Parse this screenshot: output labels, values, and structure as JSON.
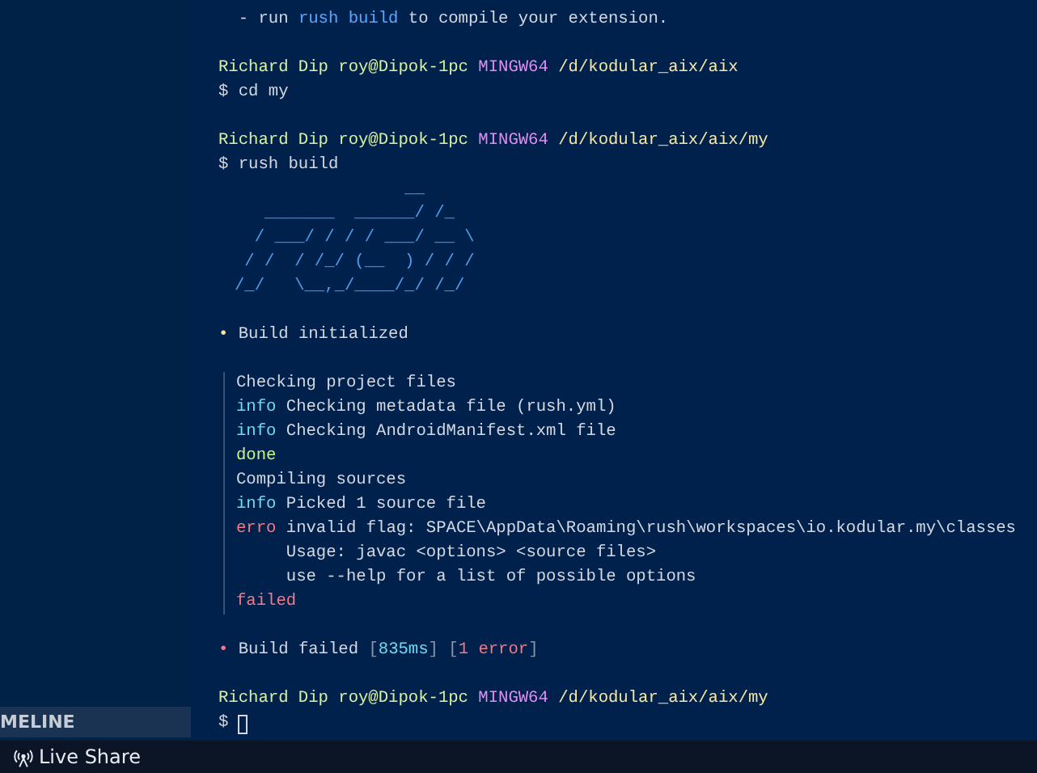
{
  "sidebar": {
    "section_header": "MELINE"
  },
  "terminal": {
    "lines": [
      {
        "kind": "text",
        "segments": [
          {
            "text": "  - run ",
            "kind": "plain"
          },
          {
            "text": "rush build",
            "kind": "command"
          },
          {
            "text": " to compile your extension.",
            "kind": "plain"
          }
        ]
      },
      {
        "kind": "blank"
      },
      {
        "kind": "text",
        "segments": [
          {
            "text": "Richard Dip roy@Dipok-1pc",
            "kind": "user"
          },
          {
            "text": " MINGW64",
            "kind": "system"
          },
          {
            "text": " /d/kodular_aix/aix",
            "kind": "path"
          }
        ]
      },
      {
        "kind": "text",
        "segments": [
          {
            "text": "$ cd my",
            "kind": "plain"
          }
        ]
      },
      {
        "kind": "blank"
      },
      {
        "kind": "text",
        "segments": [
          {
            "text": "Richard Dip roy@Dipok-1pc",
            "kind": "user"
          },
          {
            "text": " MINGW64",
            "kind": "system"
          },
          {
            "text": " /d/kodular_aix/aix/my",
            "kind": "path"
          }
        ]
      },
      {
        "kind": "text",
        "segments": [
          {
            "text": "$ rush build",
            "kind": "plain"
          }
        ]
      },
      {
        "kind": "art",
        "rows": [
          "                 __",
          "   _______  ______/ /_",
          "  / ___/ / / / ___/ __ \\",
          " / /  / /_/ (__  ) / / /",
          "/_/   \\__,_/____/_/ /_/"
        ]
      },
      {
        "kind": "blank"
      },
      {
        "kind": "text",
        "segments": [
          {
            "text": "•",
            "kind": "bullet_ok"
          },
          {
            "text": " Build initialized",
            "kind": "plain"
          }
        ]
      },
      {
        "kind": "blank"
      },
      {
        "kind": "group",
        "children": [
          {
            "kind": "text",
            "segments": [
              {
                "text": "Checking project files",
                "kind": "plain"
              }
            ]
          },
          {
            "kind": "text",
            "segments": [
              {
                "text": "info",
                "kind": "info"
              },
              {
                "text": " Checking metadata file (rush.yml)",
                "kind": "plain"
              }
            ]
          },
          {
            "kind": "text",
            "segments": [
              {
                "text": "info",
                "kind": "info"
              },
              {
                "text": " Checking AndroidManifest.xml file",
                "kind": "plain"
              }
            ]
          },
          {
            "kind": "text",
            "segments": [
              {
                "text": "done",
                "kind": "done"
              }
            ]
          }
        ]
      },
      {
        "kind": "group",
        "children": [
          {
            "kind": "text",
            "segments": [
              {
                "text": "Compiling sources",
                "kind": "plain"
              }
            ]
          },
          {
            "kind": "text",
            "segments": [
              {
                "text": "info",
                "kind": "info"
              },
              {
                "text": " Picked 1 source file",
                "kind": "plain"
              }
            ]
          },
          {
            "kind": "text",
            "segments": [
              {
                "text": "erro",
                "kind": "error"
              },
              {
                "text": " invalid flag: SPACE\\AppData\\Roaming\\rush\\workspaces\\io.kodular.my\\classes",
                "kind": "plain"
              }
            ]
          },
          {
            "kind": "text",
            "segments": [
              {
                "text": "     Usage: javac <options> <source files>",
                "kind": "plain"
              }
            ]
          },
          {
            "kind": "text",
            "segments": [
              {
                "text": "     use --help for a list of possible options",
                "kind": "plain"
              }
            ]
          },
          {
            "kind": "text",
            "segments": [
              {
                "text": "failed",
                "kind": "error"
              }
            ]
          }
        ]
      },
      {
        "kind": "blank"
      },
      {
        "kind": "text",
        "segments": [
          {
            "text": "•",
            "kind": "bullet_fail"
          },
          {
            "text": " Build failed ",
            "kind": "plain"
          },
          {
            "text": "[",
            "kind": "muted"
          },
          {
            "text": "835ms",
            "kind": "info"
          },
          {
            "text": "] [",
            "kind": "muted"
          },
          {
            "text": "1 error",
            "kind": "error"
          },
          {
            "text": "]",
            "kind": "muted"
          }
        ]
      },
      {
        "kind": "blank"
      },
      {
        "kind": "text",
        "segments": [
          {
            "text": "Richard Dip roy@Dipok-1pc",
            "kind": "user"
          },
          {
            "text": " MINGW64",
            "kind": "system"
          },
          {
            "text": " /d/kodular_aix/aix/my",
            "kind": "path"
          }
        ]
      },
      {
        "kind": "input",
        "prompt": "$"
      }
    ]
  },
  "status_bar": {
    "items": [
      {
        "label": "Live Share"
      }
    ]
  }
}
